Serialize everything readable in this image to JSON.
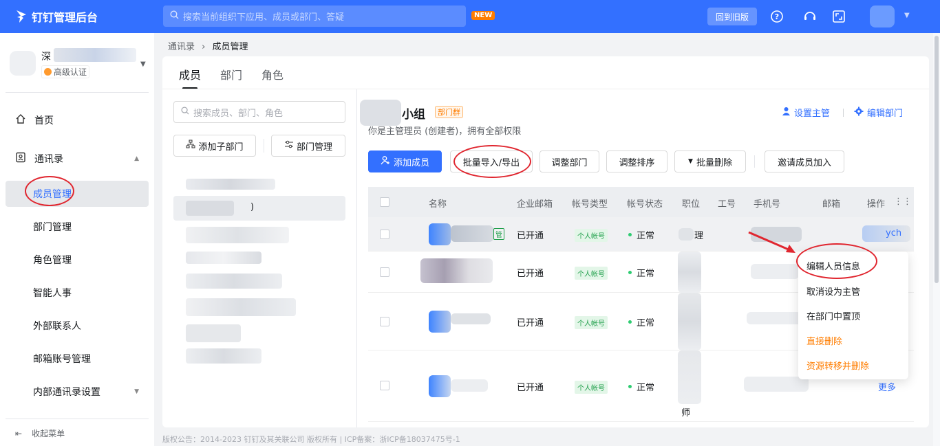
{
  "app": {
    "title": "钉钉管理后台",
    "brand_color": "#3370ff"
  },
  "topbar": {
    "search_placeholder": "搜索当前组织下应用、成员或部门、答疑",
    "new_badge": "NEW",
    "old_version": "回到旧版"
  },
  "org": {
    "name": "深",
    "auth_label": "高级认证"
  },
  "sidebar": {
    "items": [
      {
        "label": "首页",
        "icon": "home-icon"
      },
      {
        "label": "通讯录",
        "icon": "contacts-icon"
      },
      {
        "label": "成员管理"
      },
      {
        "label": "部门管理"
      },
      {
        "label": "角色管理"
      },
      {
        "label": "智能人事"
      },
      {
        "label": "外部联系人"
      },
      {
        "label": "邮箱账号管理"
      },
      {
        "label": "内部通讯录设置"
      }
    ],
    "collapse": "收起菜单"
  },
  "breadcrumb": {
    "parent": "通讯录",
    "current": "成员管理"
  },
  "tabs": [
    "成员",
    "部门",
    "角色"
  ],
  "dept_panel": {
    "search_placeholder": "搜索成员、部门、角色",
    "add_sub": "添加子部门",
    "manage": "部门管理",
    "selected_suffix": ")"
  },
  "group": {
    "title": "小组",
    "tag": "部门群",
    "desc": "你是主管理员 (创建者)，拥有全部权限",
    "set_manager": "设置主管",
    "edit_dept": "编辑部门"
  },
  "buttons": {
    "add_member": "添加成员",
    "import_export": "批量导入/导出",
    "adjust_dept": "调整部门",
    "adjust_order": "调整排序",
    "batch_delete": "批量删除",
    "invite": "邀请成员加入"
  },
  "table": {
    "headers": [
      "名称",
      "企业邮箱",
      "帐号类型",
      "帐号状态",
      "职位",
      "工号",
      "手机号",
      "邮箱",
      "操作"
    ],
    "rows": [
      {
        "email_status": "已开通",
        "type": "个人帐号",
        "status": "正常",
        "tag": "管",
        "pos": "理",
        "op": "ych"
      },
      {
        "email_status": "已开通",
        "type": "个人帐号",
        "status": "正常"
      },
      {
        "email_status": "已开通",
        "type": "个人帐号",
        "status": "正常"
      },
      {
        "email_status": "已开通",
        "type": "个人帐号",
        "status": "正常",
        "pos": "师",
        "op": "更多"
      }
    ]
  },
  "menu": {
    "items": [
      "编辑人员信息",
      "取消设为主管",
      "在部门中置顶",
      "直接删除",
      "资源转移并删除"
    ]
  },
  "footer": "版权公告：2014-2023 钉钉及其关联公司 版权所有 | ICP备案：浙ICP备18037475号-1"
}
